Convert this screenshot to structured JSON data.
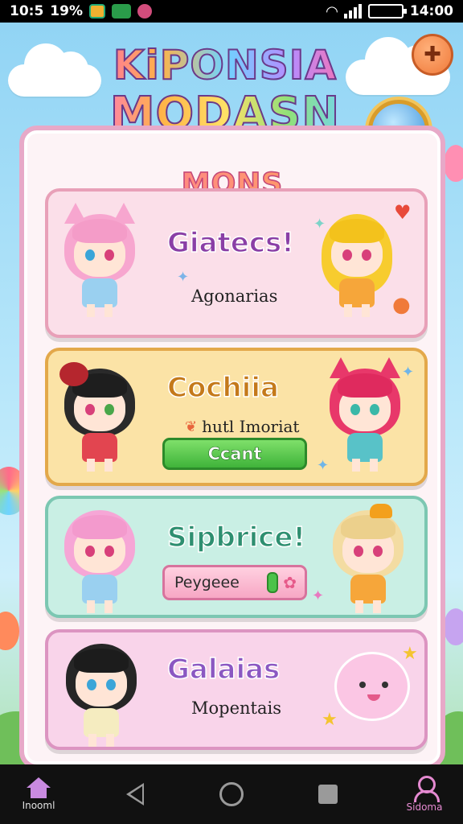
{
  "status_bar": {
    "time_left": "10:5",
    "battery_left": "19%",
    "time_right": "14:00"
  },
  "title": {
    "line1": "KiPONSIA",
    "line2": "MODASN"
  },
  "section": {
    "title": "MONS"
  },
  "cards": [
    {
      "title": "Giatecs!",
      "subtitle": "Agonarias",
      "theme": "#fbdfe9"
    },
    {
      "title": "Cochiia",
      "note": "hutl Imoriat",
      "button_label": "Ccant",
      "theme": "#fbe3a6"
    },
    {
      "title": "Sipbrice!",
      "input_value": "Peygeee",
      "theme": "#c9efe4"
    },
    {
      "title": "Galaias",
      "subtitle": "Mopentais",
      "theme": "#f9d4ea"
    }
  ],
  "nav": {
    "home_label": "Inooml",
    "profile_label": "Sidoma"
  },
  "colors": {
    "accent_pink": "#e58ad1",
    "panel_border": "#e7a9c8",
    "button_green": "#3fb33a"
  },
  "icons": {
    "settings": "bandage-icon",
    "globe": "globe-icon",
    "home": "home-icon",
    "back": "back-icon",
    "overview": "circle-home-icon",
    "recents": "square-icon",
    "profile": "profile-icon"
  }
}
